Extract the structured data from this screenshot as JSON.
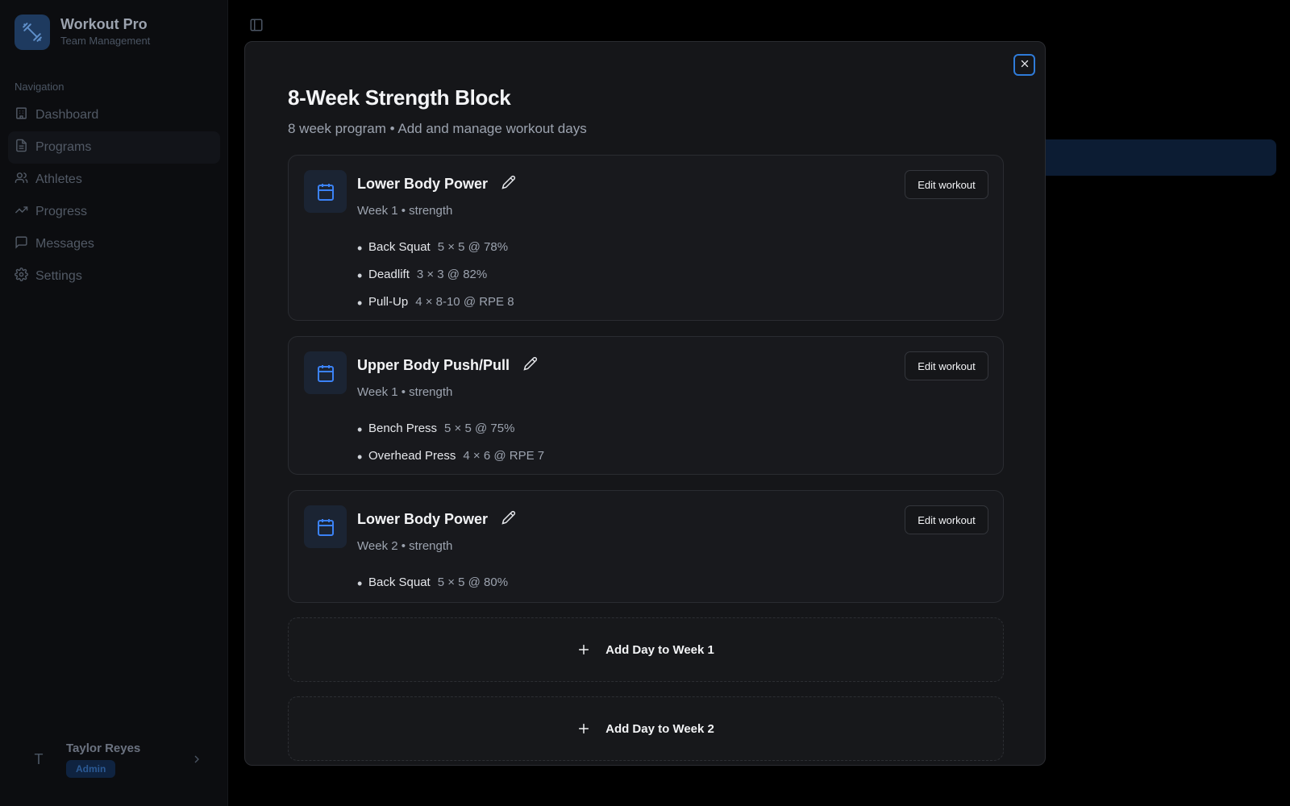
{
  "app": {
    "name": "Workout Pro",
    "subtitle": "Team Management"
  },
  "sidebar": {
    "heading": "Navigation",
    "items": [
      {
        "label": "Dashboard",
        "icon": "dashboard-icon",
        "active": false
      },
      {
        "label": "Programs",
        "icon": "document-icon",
        "active": true
      },
      {
        "label": "Athletes",
        "icon": "users-icon",
        "active": false
      },
      {
        "label": "Progress",
        "icon": "trending-up-icon",
        "active": false
      },
      {
        "label": "Messages",
        "icon": "message-icon",
        "active": false
      },
      {
        "label": "Settings",
        "icon": "gear-icon",
        "active": false
      }
    ]
  },
  "user": {
    "initial": "T",
    "name": "Taylor Reyes",
    "role": "Admin"
  },
  "modal": {
    "title": "8-Week Strength Block",
    "subtitle": "8 week program • Add and manage workout days",
    "edit_label": "Edit workout",
    "days": [
      {
        "name": "Lower Body Power",
        "meta": "Week 1 • strength",
        "exercises": [
          {
            "name": "Back Squat",
            "detail": "5 × 5 @ 78%"
          },
          {
            "name": "Deadlift",
            "detail": "3 × 3 @ 82%"
          },
          {
            "name": "Pull-Up",
            "detail": "4 × 8-10 @ RPE 8"
          }
        ]
      },
      {
        "name": "Upper Body Push/Pull",
        "meta": "Week 1 • strength",
        "exercises": [
          {
            "name": "Bench Press",
            "detail": "5 × 5 @ 75%"
          },
          {
            "name": "Overhead Press",
            "detail": "4 × 6 @ RPE 7"
          }
        ]
      },
      {
        "name": "Lower Body Power",
        "meta": "Week 2 • strength",
        "exercises": [
          {
            "name": "Back Squat",
            "detail": "5 × 5 @ 80%"
          }
        ]
      }
    ],
    "add_buttons": [
      {
        "label": "Add Day to Week 1"
      },
      {
        "label": "Add Day to Week 2"
      }
    ]
  },
  "colors": {
    "accent": "#3b82f6",
    "background": "#000000",
    "modal": "#151619",
    "card": "#18191d"
  }
}
